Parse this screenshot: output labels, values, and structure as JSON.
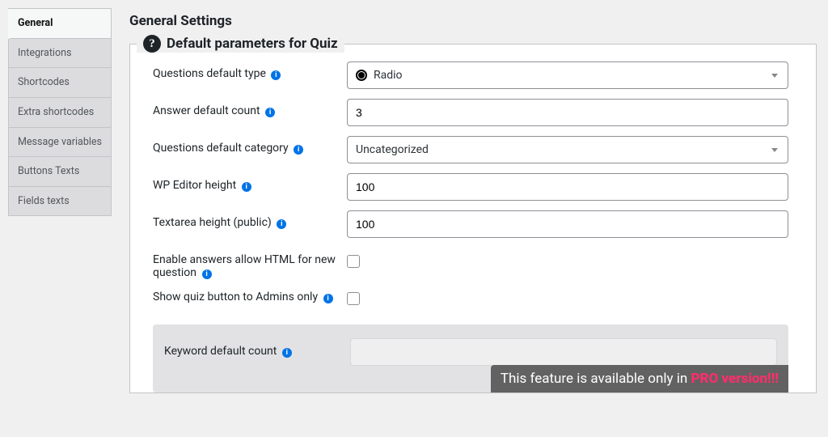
{
  "sidebar": {
    "items": [
      {
        "label": "General"
      },
      {
        "label": "Integrations"
      },
      {
        "label": "Shortcodes"
      },
      {
        "label": "Extra shortcodes"
      },
      {
        "label": "Message variables"
      },
      {
        "label": "Buttons Texts"
      },
      {
        "label": "Fields texts"
      }
    ],
    "active_index": 0
  },
  "header": {
    "title": "General Settings"
  },
  "panel": {
    "legend": "Default parameters for Quiz",
    "fields": {
      "question_type": {
        "label": "Questions default type",
        "value": "Radio"
      },
      "answer_count": {
        "label": "Answer default count",
        "value": "3"
      },
      "question_category": {
        "label": "Questions default category",
        "value": "Uncategorized"
      },
      "wp_editor_height": {
        "label": "WP Editor height",
        "value": "100"
      },
      "textarea_height": {
        "label": "Textarea height (public)",
        "value": "100"
      },
      "allow_html": {
        "label": "Enable answers allow HTML for new question",
        "checked": false
      },
      "admins_only": {
        "label": "Show quiz button to Admins only",
        "checked": false
      },
      "keyword_count": {
        "label": "Keyword default count",
        "value": ""
      }
    },
    "pro_notice": {
      "prefix": "This feature is available only in ",
      "highlight": "PRO version!!!"
    }
  }
}
